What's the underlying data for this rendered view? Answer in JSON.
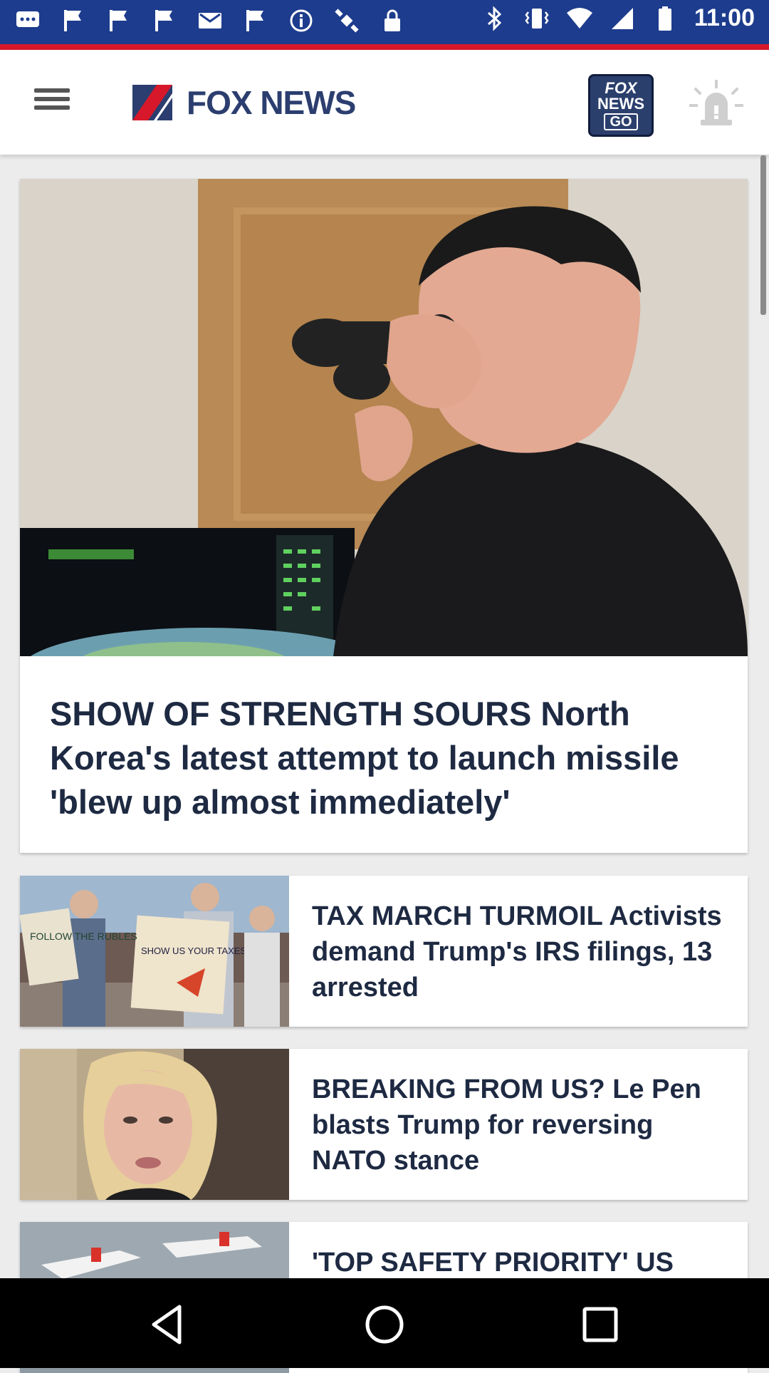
{
  "status_bar": {
    "time": "11:00",
    "left_icons": [
      "message-icon",
      "flag-icon",
      "flag-icon",
      "flag-icon",
      "mail-icon",
      "flag-icon",
      "info-icon",
      "satellite-icon",
      "lock-icon"
    ],
    "right_icons": [
      "bluetooth-icon",
      "vibrate-icon",
      "wifi-icon",
      "signal-icon",
      "battery-icon"
    ]
  },
  "header": {
    "logo_text": "FOX NEWS",
    "go_label_line1": "FOX",
    "go_label_line2": "NEWS",
    "go_label_line3": "GO"
  },
  "articles": [
    {
      "title": "SHOW OF STRENGTH SOURS North Korea's latest attempt to launch missile 'blew up almost immediately'"
    },
    {
      "title": "TAX MARCH TURMOIL Activists demand Trump's IRS filings, 13 arrested",
      "thumb_sign_1": "FOLLOW THE RUBLES",
      "thumb_sign_2": "SHOW US YOUR TAXES!"
    },
    {
      "title": "BREAKING FROM US? Le Pen blasts Trump for reversing NATO stance"
    },
    {
      "title": "'TOP SAFETY PRIORITY' US"
    }
  ],
  "colors": {
    "status_bar": "#1d3c8d",
    "accent_red": "#d6182a",
    "headline_text": "#1e2a42",
    "logo_navy": "#2c3e6f"
  }
}
